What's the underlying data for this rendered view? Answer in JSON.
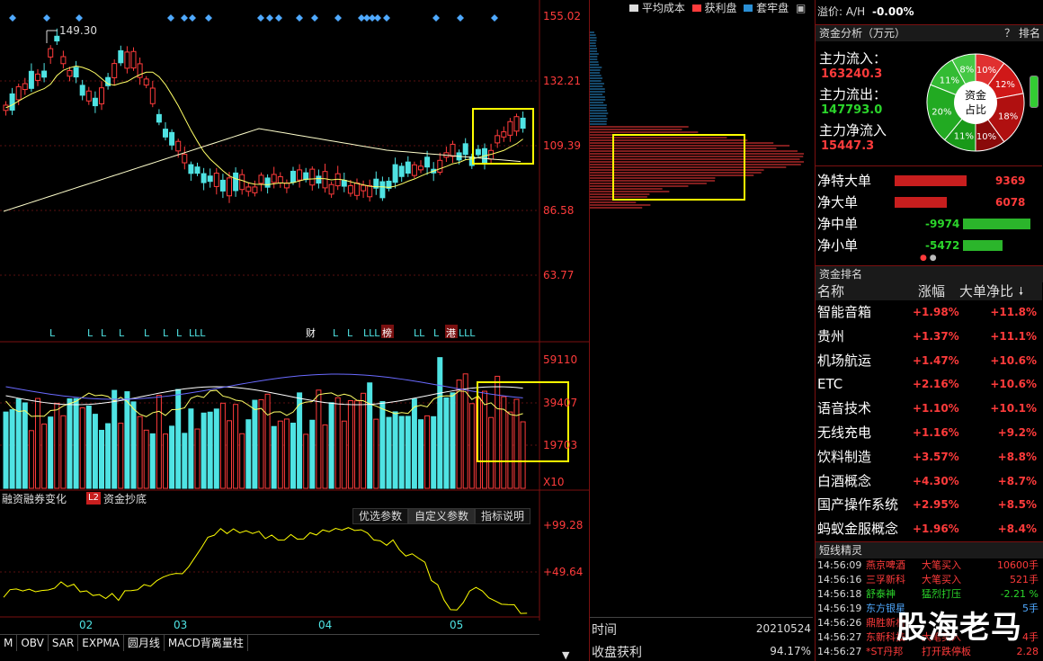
{
  "colors": {
    "up": "#ff3b3b",
    "down": "#4fe3e3",
    "accent": "#ffff00",
    "bg": "#000000"
  },
  "price_axis": [
    "155.02",
    "132.21",
    "109.39",
    "86.58",
    "63.77"
  ],
  "peak_label": "149.30",
  "volume_axis": [
    "59110",
    "39407",
    "19703",
    "X10"
  ],
  "indicator_axis": [
    "+99.28",
    "+49.64"
  ],
  "month_labels": [
    "02",
    "03",
    "04",
    "05"
  ],
  "event_marks": [
    "L",
    "L",
    "L",
    "L",
    "L",
    "L",
    "L",
    "LLL",
    "财",
    "L",
    "L",
    "LLL",
    "榜",
    "LL",
    "L",
    "港",
    "LLL"
  ],
  "indicator_tabs": {
    "margin": "融资融券变化",
    "l2_badge": "L2",
    "fund": "资金抄底"
  },
  "param_tabs": [
    "优选参数",
    "自定义参数",
    "指标说明"
  ],
  "bottom_tabs": [
    "M",
    "OBV",
    "SAR",
    "EXPMA",
    "圆月线",
    "MACD背离量柱"
  ],
  "chip_legend": [
    "平均成本",
    "获利盘",
    "套牢盘"
  ],
  "chip_footer": {
    "time_label": "时间",
    "time_value": "20210524",
    "profit_label": "收盘获利",
    "profit_value": "94.17%"
  },
  "premium": {
    "label": "溢价: A/H",
    "value": "-0.00%"
  },
  "fund_analysis": {
    "title": "资金分析（万元）",
    "help": "？ 排名",
    "inflow_label": "主力流入：",
    "inflow_value": "163240.3",
    "outflow_label": "主力流出：",
    "outflow_value": "147793.0",
    "net_label": "主力净流入",
    "net_value": "15447.3",
    "donut_center": [
      "资金",
      "占比"
    ],
    "donut_labels": [
      "8%",
      "10%",
      "12%",
      "18%",
      "10%",
      "11%",
      "20%",
      "11%"
    ]
  },
  "net_flows": [
    {
      "label": "净特大单",
      "value": "9369",
      "fill": 0.75
    },
    {
      "label": "净大单",
      "value": "6078",
      "fill": 0.55
    },
    {
      "label": "净中单",
      "value": "-9974",
      "fill": 0.85
    },
    {
      "label": "净小单",
      "value": "-5472",
      "fill": 0.5
    }
  ],
  "fund_rank": {
    "title": "资金排名",
    "columns": [
      "名称",
      "涨幅",
      "大单净比"
    ],
    "rows": [
      {
        "name": "智能音箱",
        "change": "+1.98%",
        "ratio": "+11.8%"
      },
      {
        "name": "贵州",
        "change": "+1.37%",
        "ratio": "+11.1%"
      },
      {
        "name": "机场航运",
        "change": "+1.47%",
        "ratio": "+10.6%"
      },
      {
        "name": "ETC",
        "change": "+2.16%",
        "ratio": "+10.6%"
      },
      {
        "name": "语音技术",
        "change": "+1.10%",
        "ratio": "+10.1%"
      },
      {
        "name": "无线充电",
        "change": "+1.16%",
        "ratio": "+9.2%"
      },
      {
        "name": "饮料制造",
        "change": "+3.57%",
        "ratio": "+8.8%"
      },
      {
        "name": "白酒概念",
        "change": "+4.30%",
        "ratio": "+8.7%"
      },
      {
        "name": "国产操作系统",
        "change": "+2.95%",
        "ratio": "+8.5%"
      },
      {
        "name": "蚂蚁金服概念",
        "change": "+1.96%",
        "ratio": "+8.4%"
      }
    ]
  },
  "short_line": {
    "title": "短线精灵",
    "rows": [
      {
        "time": "14:56:09",
        "stock": "燕京啤酒",
        "action": "大笔买入",
        "value": "10600手"
      },
      {
        "time": "14:56:16",
        "stock": "三孚新科",
        "action": "大笔买入",
        "value": "521手"
      },
      {
        "time": "14:56:18",
        "stock": "舒泰神",
        "action": "猛烈打压",
        "value": "-2.21 %"
      },
      {
        "time": "14:56:19",
        "stock": "东方银星",
        "action": "",
        "value": "5手"
      },
      {
        "time": "14:56:26",
        "stock": "鼎胜新材",
        "action": "",
        "value": ""
      },
      {
        "time": "14:56:27",
        "stock": "东新科技",
        "action": "大笔买入",
        "value": "4手"
      },
      {
        "time": "14:56:27",
        "stock": "*ST丹邦",
        "action": "打开跌停板",
        "value": "2.28"
      }
    ]
  },
  "watermark": "股海老马"
}
